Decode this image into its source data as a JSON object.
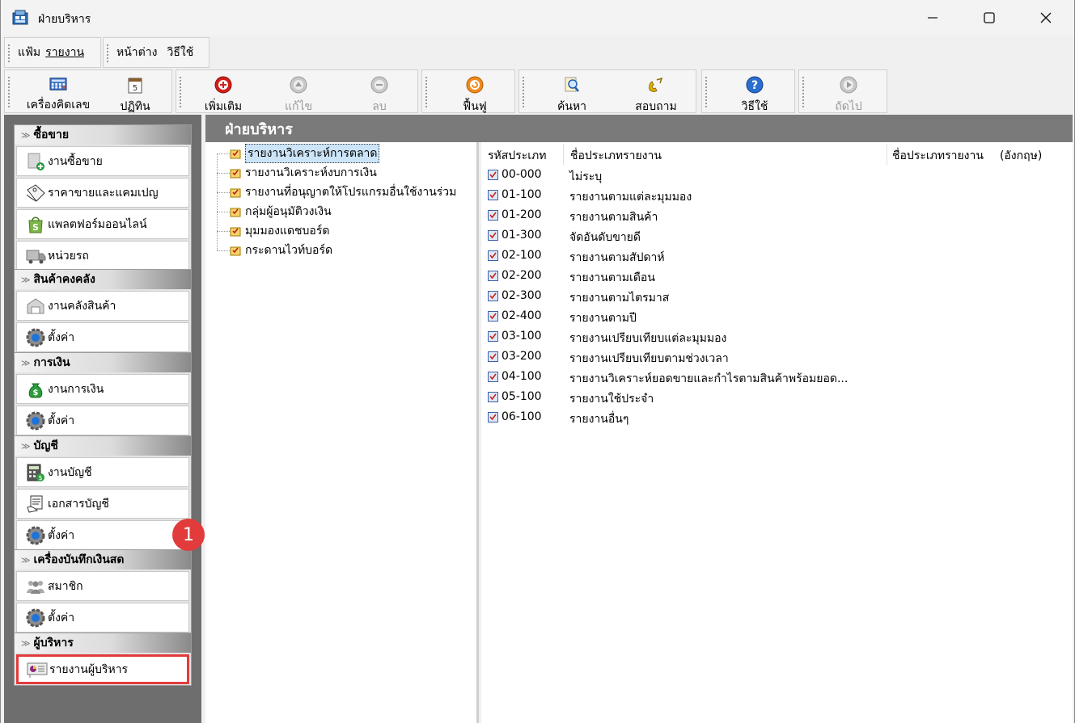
{
  "window": {
    "title": "ฝ่ายบริหาร"
  },
  "menubar": {
    "file": "แฟ้ม",
    "report": "รายงาน",
    "window": "หน้าต่าง",
    "help": "วิธีใช้"
  },
  "toolbar": {
    "calculator": "เครื่องคิดเลข",
    "calendar": "ปฏิทิน",
    "add": "เพิ่มเติม",
    "edit": "แก้ไข",
    "delete": "ลบ",
    "restore": "ฟื้นฟู",
    "search": "ค้นหา",
    "inquiry": "สอบถาม",
    "help": "วิธีใช้",
    "next": "ถัดไป"
  },
  "nav": {
    "sales": {
      "header": "ซื้อขาย",
      "items": [
        "งานซื้อขาย",
        "ราคาขายและแคมเปญ",
        "แพลตฟอร์มออนไลน์",
        "หน่วยรถ"
      ]
    },
    "inventory": {
      "header": "สินค้าคงคลัง",
      "items": [
        "งานคลังสินค้า",
        "ตั้งค่า"
      ]
    },
    "finance": {
      "header": "การเงิน",
      "items": [
        "งานการเงิน",
        "ตั้งค่า"
      ]
    },
    "accounting": {
      "header": "บัญชี",
      "items": [
        "งานบัญชี",
        "เอกสารบัญชี",
        "ตั้งค่า"
      ]
    },
    "cashregister": {
      "header": "เครื่องบันทึกเงินสด",
      "items": [
        "สมาชิก",
        "ตั้งค่า"
      ]
    },
    "executive": {
      "header": "ผู้บริหาร",
      "items": [
        "รายงานผู้บริหาร"
      ]
    }
  },
  "badge": "1",
  "main": {
    "header": "ฝ่ายบริหาร"
  },
  "tree": {
    "items": [
      "รายงานวิเคราะห์การตลาด",
      "รายงานวิเคราะห์งบการเงิน",
      "รายงานที่อนุญาตให้โปรแกรมอื่นใช้งานร่วม",
      "กลุ่มผู้อนุมัติวงเงิน",
      "มุมมองแดชบอร์ด",
      "กระดานไวท์บอร์ด"
    ]
  },
  "list": {
    "columns": {
      "code": "รหัสประเภท",
      "name": "ชื่อประเภทรายงาน",
      "name_en": "ชื่อประเภทรายงาน",
      "name_en_suffix": "(อังกฤษ)"
    },
    "rows": [
      {
        "code": "00-000",
        "name": "ไม่ระบุ"
      },
      {
        "code": "01-100",
        "name": "รายงานตามแต่ละมุมมอง"
      },
      {
        "code": "01-200",
        "name": "รายงานตามสินค้า"
      },
      {
        "code": "01-300",
        "name": "จัดอันดับขายดี"
      },
      {
        "code": "02-100",
        "name": "รายงานตามสัปดาห์"
      },
      {
        "code": "02-200",
        "name": "รายงานตามเดือน"
      },
      {
        "code": "02-300",
        "name": "รายงานตามไตรมาส"
      },
      {
        "code": "02-400",
        "name": "รายงานตามปี"
      },
      {
        "code": "03-100",
        "name": "รายงานเปรียบเทียบแต่ละมุมมอง"
      },
      {
        "code": "03-200",
        "name": "รายงานเปรียบเทียบตามช่วงเวลา"
      },
      {
        "code": "04-100",
        "name": "รายงานวิเคราะห์ยอดขายและกำไรตามสินค้าพร้อมยอด..."
      },
      {
        "code": "05-100",
        "name": "รายงานใช้ประจำ"
      },
      {
        "code": "06-100",
        "name": "รายงานอื่นๆ"
      }
    ]
  }
}
